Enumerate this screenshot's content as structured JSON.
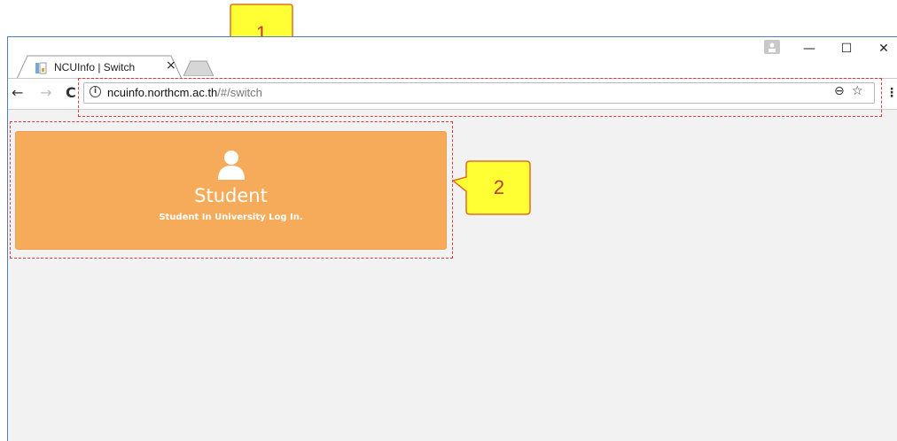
{
  "tab": {
    "title": "NCUInfo | Switch",
    "close": "×"
  },
  "window_controls": {
    "minimize": "—",
    "maximize": "☐",
    "close": "✕"
  },
  "nav": {
    "back": "←",
    "forward": "→",
    "reload": "C"
  },
  "address": {
    "host": "ncuinfo.northcm.ac.th",
    "path": "/#/switch",
    "info": "i"
  },
  "toolbar_icons": {
    "zoom": "⊖",
    "star": "☆",
    "menu": "⋮"
  },
  "card": {
    "title": "Student",
    "subtitle": "Student In University Log In.",
    "color": "#f5ab5a"
  },
  "annotations": [
    {
      "label": "1"
    },
    {
      "label": "2"
    }
  ],
  "colors": {
    "annotation_border": "#e0373a",
    "callout_fill": "#ffff33",
    "callout_stroke": "#e07020"
  }
}
